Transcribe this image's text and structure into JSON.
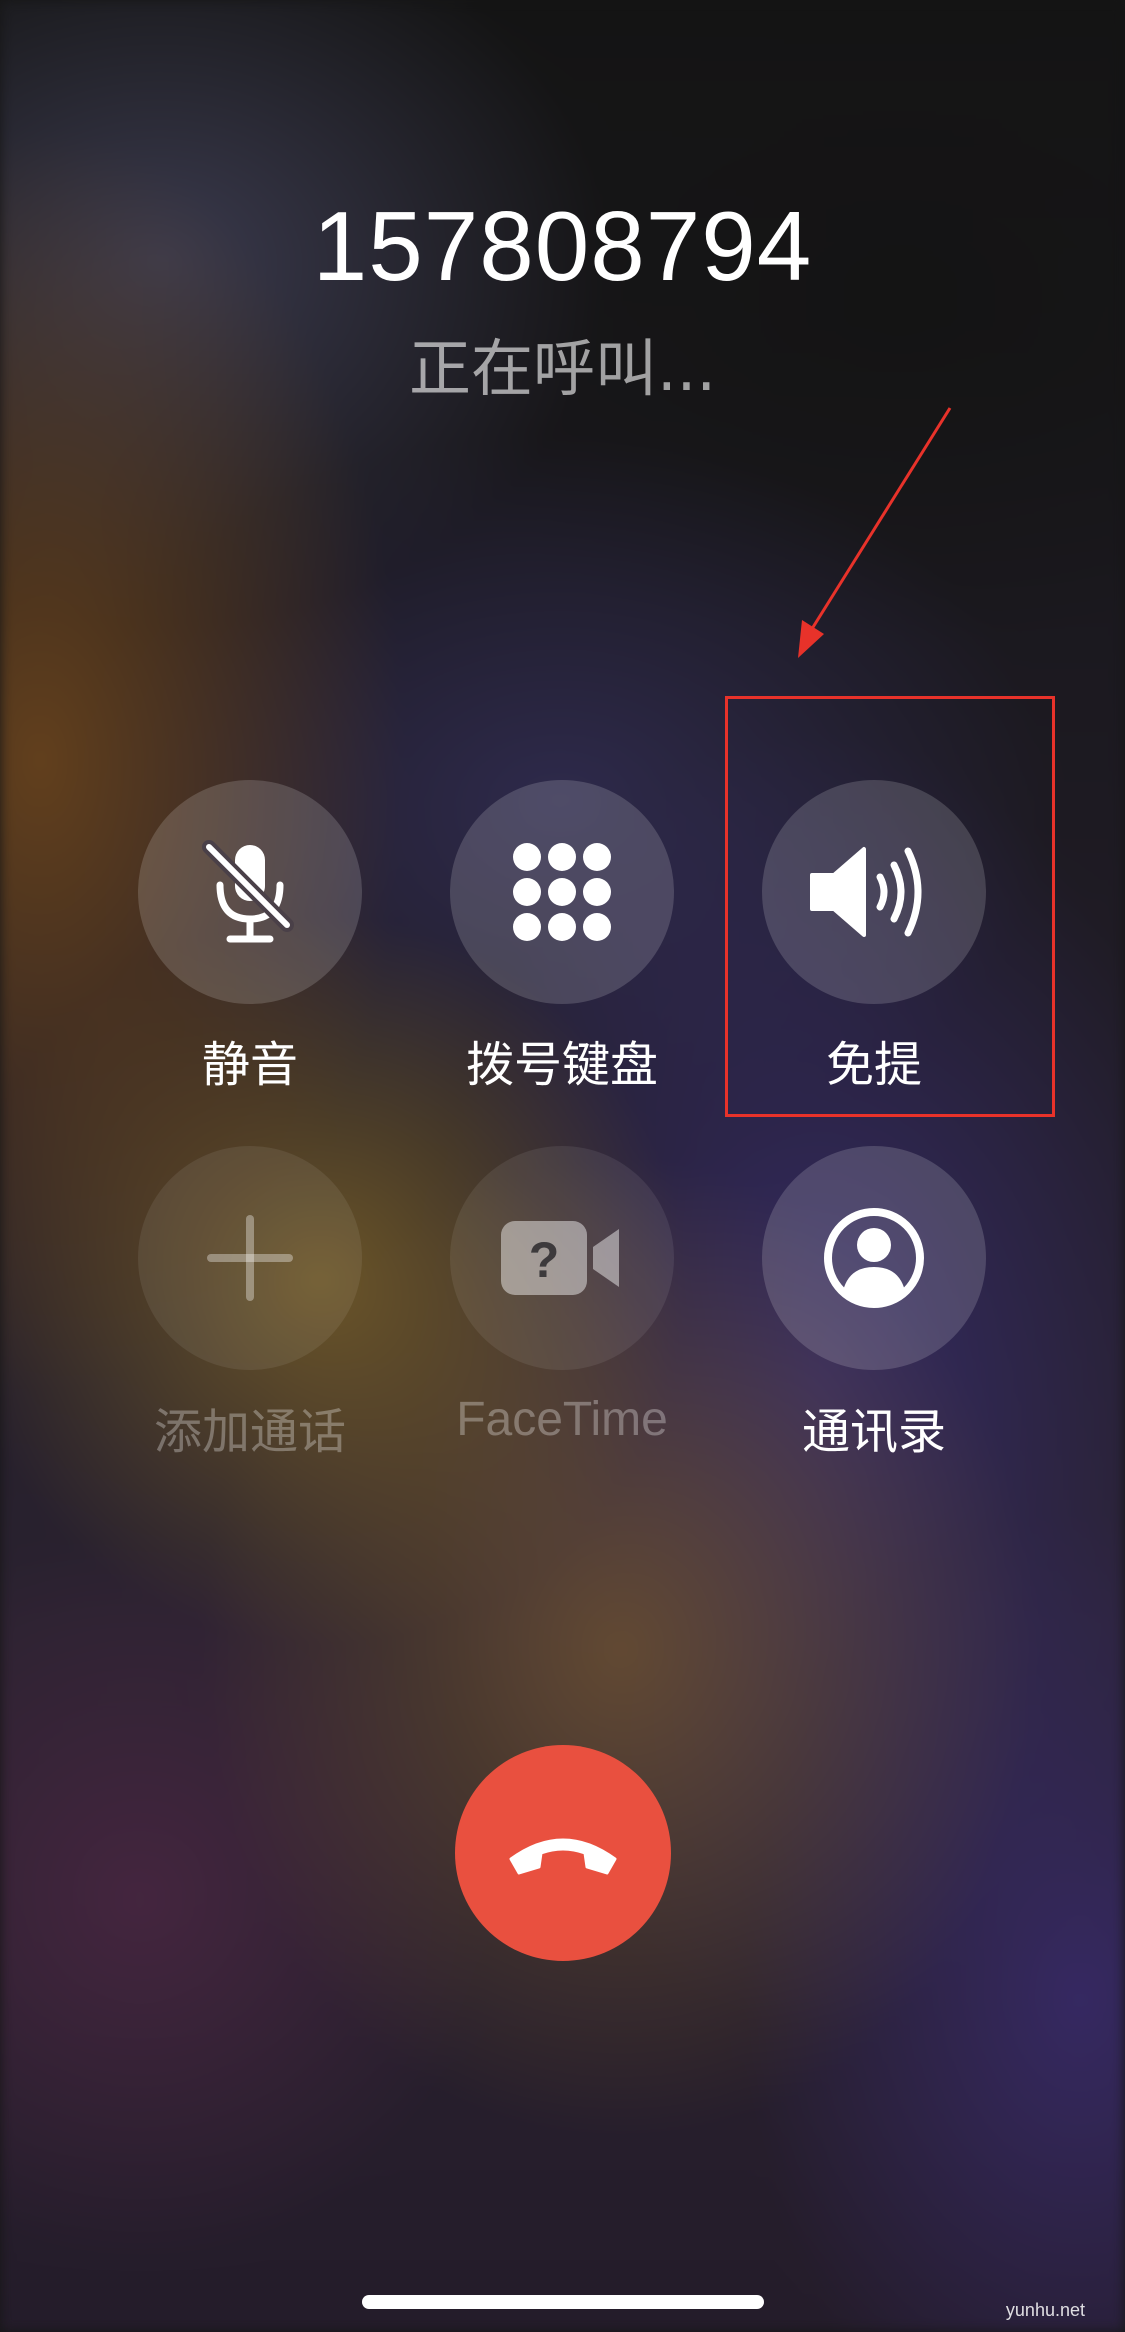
{
  "call": {
    "number": "157808794",
    "status": "正在呼叫..."
  },
  "controls": [
    {
      "label": "静音",
      "icon": "mute-microphone-icon",
      "enabled": true
    },
    {
      "label": "拨号键盘",
      "icon": "keypad-icon",
      "enabled": true
    },
    {
      "label": "免提",
      "icon": "speaker-icon",
      "enabled": true
    },
    {
      "label": "添加通话",
      "icon": "plus-icon",
      "enabled": false
    },
    {
      "label": "FaceTime",
      "icon": "facetime-video-icon",
      "enabled": false
    },
    {
      "label": "通讯录",
      "icon": "contact-icon",
      "enabled": true
    }
  ],
  "end_call": {
    "icon": "end-call-icon",
    "color": "#e9503f"
  },
  "annotation": {
    "color": "#e8322a",
    "target": "speaker"
  },
  "watermark": "yunhu.net"
}
